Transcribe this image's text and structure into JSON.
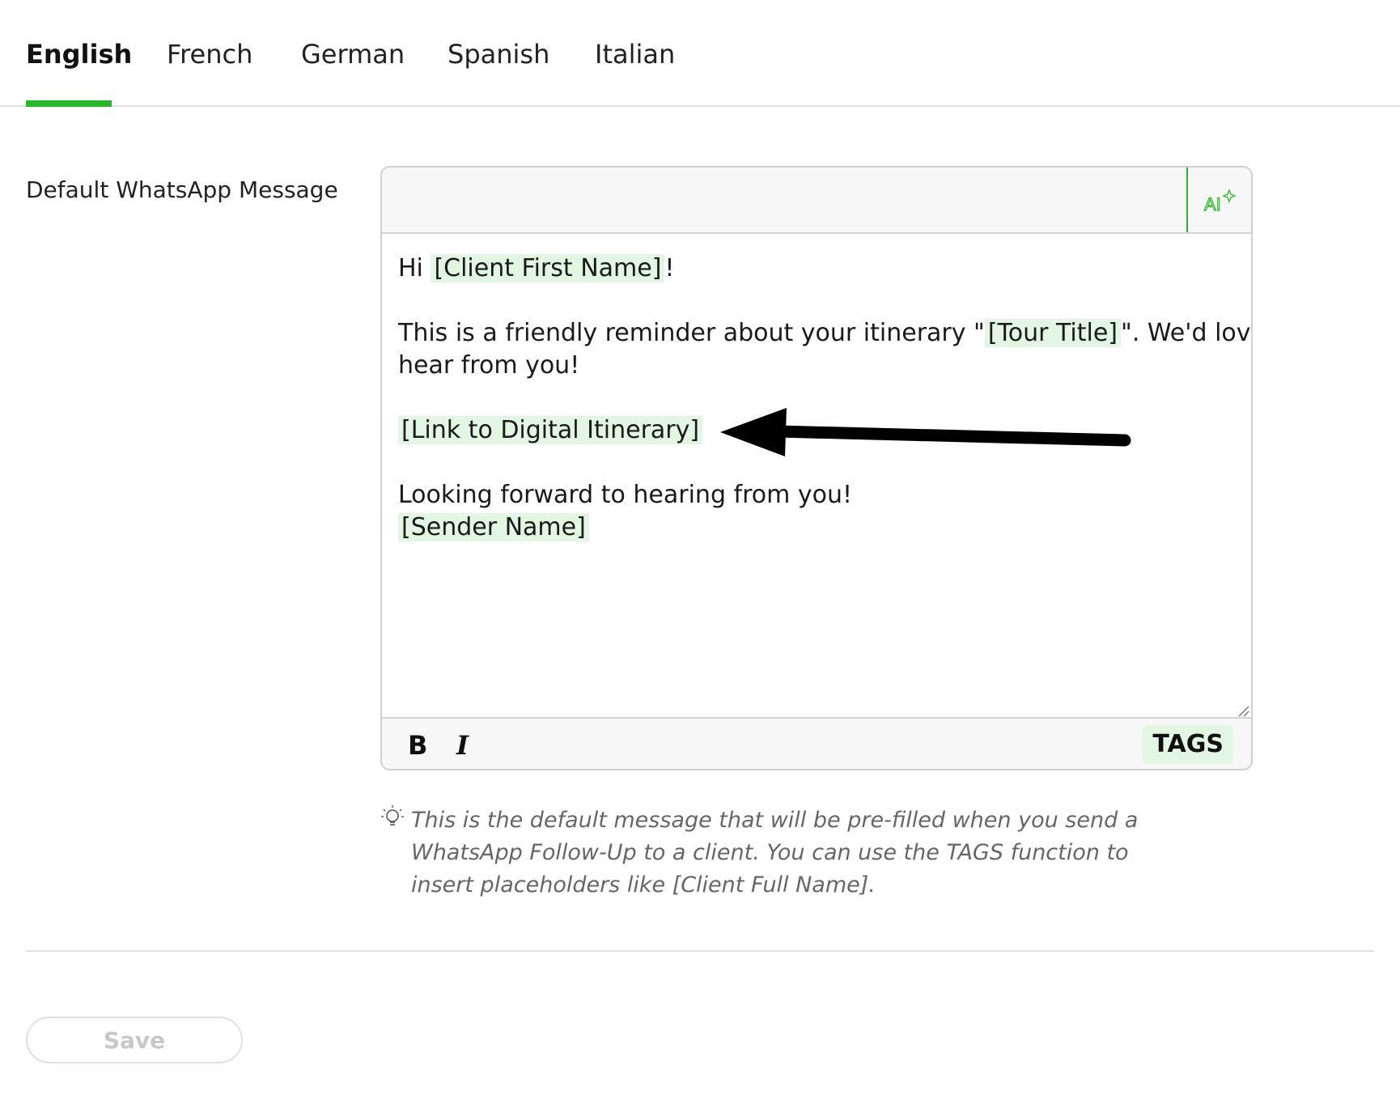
{
  "tabs": [
    {
      "label": "English",
      "active": true
    },
    {
      "label": "French",
      "active": false
    },
    {
      "label": "German",
      "active": false
    },
    {
      "label": "Spanish",
      "active": false
    },
    {
      "label": "Italian",
      "active": false
    }
  ],
  "field": {
    "label": "Default WhatsApp Message"
  },
  "message": {
    "greeting_prefix": "Hi ",
    "tag_client_first_name": "[Client First Name]",
    "greeting_suffix": "!",
    "reminder_prefix": "This is a friendly reminder about your itinerary \"",
    "tag_tour_title": "[Tour Title]",
    "reminder_suffix": "\". We'd love to",
    "reminder_line2": "hear from you!",
    "tag_link": "[Link to Digital Itinerary]",
    "closing": "Looking forward to hearing from you!",
    "tag_sender": "[Sender Name]"
  },
  "toolbar": {
    "bold_label": "B",
    "italic_label": "I",
    "tags_label": "TAGS"
  },
  "hint": {
    "text": "This is the default message that will be pre-filled when you send a WhatsApp Follow-Up to a client. You can use the TAGS function to insert placeholders like [Client Full Name]."
  },
  "save": {
    "label": "Save",
    "enabled": false
  },
  "colors": {
    "accent": "#2ab52a",
    "tag_bg": "#e3f5e3",
    "hint_text": "#666666",
    "disabled_text": "#c8c8c8"
  },
  "icons": {
    "ai": "ai-sparkle-icon",
    "hint": "lightbulb-icon",
    "annotation": "arrow-left-icon"
  }
}
